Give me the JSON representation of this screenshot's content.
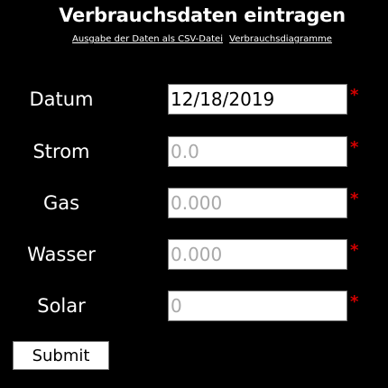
{
  "page": {
    "title": "Verbrauchsdaten eintragen"
  },
  "links": {
    "csv_export": "Ausgabe der Daten als CSV-Datei",
    "diagrams": "Verbrauchsdiagramme"
  },
  "form": {
    "required_marker": "*",
    "required_color": "#d40000",
    "fields": {
      "datum": {
        "label": "Datum",
        "value": "12/18/2019",
        "placeholder": ""
      },
      "strom": {
        "label": "Strom",
        "value": "",
        "placeholder": "0.0"
      },
      "gas": {
        "label": "Gas",
        "value": "",
        "placeholder": "0.000"
      },
      "wasser": {
        "label": "Wasser",
        "value": "",
        "placeholder": "0.000"
      },
      "solar": {
        "label": "Solar",
        "value": "",
        "placeholder": "0"
      }
    },
    "submit_label": "Submit"
  }
}
